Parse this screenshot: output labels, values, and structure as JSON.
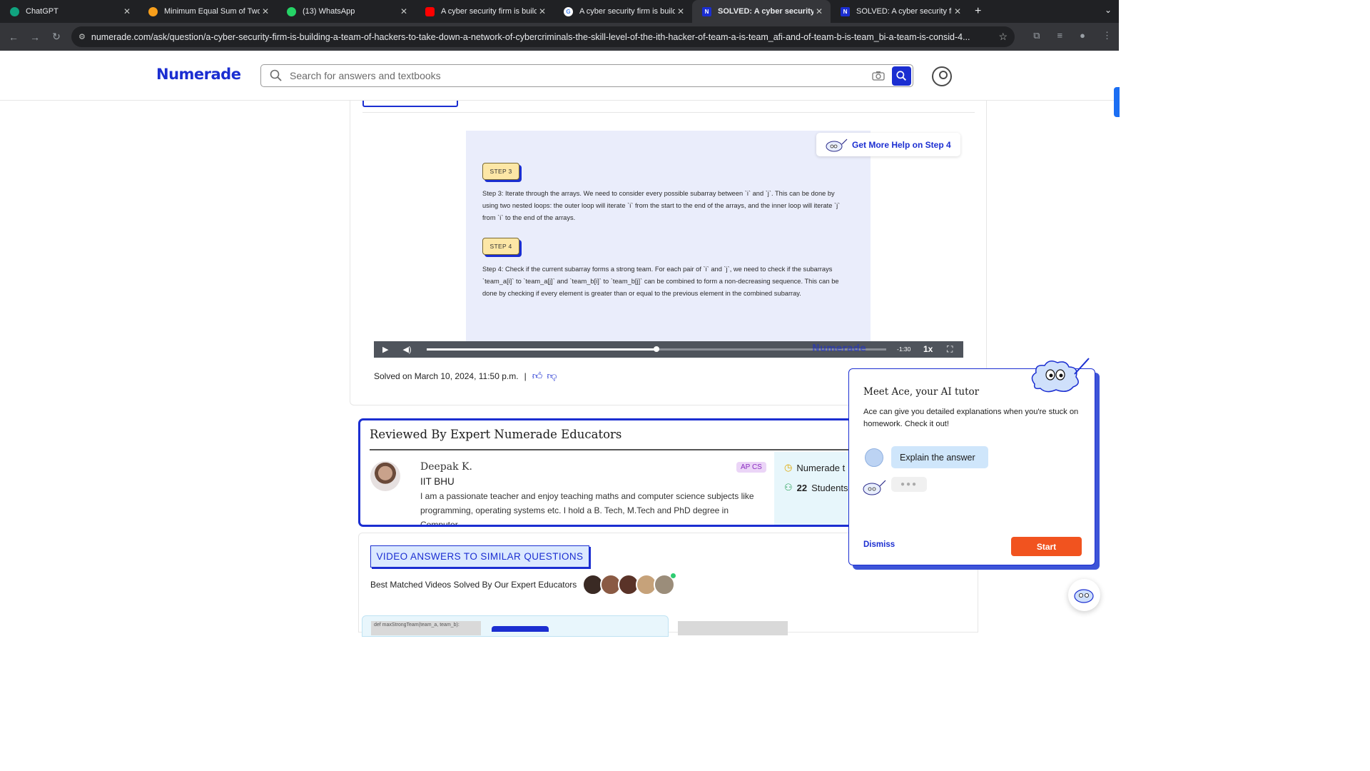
{
  "browser": {
    "tabs": [
      {
        "title": "ChatGPT",
        "favicon": "chatgpt-icon",
        "color": "#10a37f"
      },
      {
        "title": "Minimum Equal Sum of Two Arrays",
        "favicon": "leetcode-icon",
        "color": "#f89f1b"
      },
      {
        "title": "(13) WhatsApp",
        "favicon": "whatsapp-icon",
        "color": "#25d366"
      },
      {
        "title": "A cyber security firm is building",
        "favicon": "youtube-icon",
        "color": "#ff0000"
      },
      {
        "title": "A cyber security firm is building",
        "favicon": "google-icon",
        "color": "#4285f4"
      },
      {
        "title": "SOLVED: A cyber security firm",
        "favicon": "numerade-icon",
        "color": "#1b2ed1"
      },
      {
        "title": "SOLVED: A cyber security firm",
        "favicon": "numerade-icon",
        "color": "#1b2ed1"
      }
    ],
    "active_tab": 5,
    "url": "numerade.com/ask/question/a-cyber-security-firm-is-building-a-team-of-hackers-to-take-down-a-network-of-cybercriminals-the-skill-level-of-the-ith-hacker-of-team-a-is-team_afi-and-of-team-b-is-team_bi-a-team-is-consid-4..."
  },
  "header": {
    "logo": "Numerade",
    "search_placeholder": "Search for answers and textbooks"
  },
  "video": {
    "help_label": "Get More Help on Step 4",
    "steps": [
      {
        "badge": "STEP 3",
        "text": "Step 3: Iterate through the arrays. We need to consider every possible subarray between `i` and `j`. This can be done by using two nested loops: the outer loop will iterate `i` from the start to the end of the arrays, and the inner loop will iterate `j` from `i` to the end of the arrays."
      },
      {
        "badge": "STEP 4",
        "text": "Step 4: Check if the current subarray forms a strong team. For each pair of `i` and `j`, we need to check if the subarrays `team_a[i]` to `team_a[j]` and `team_b[i]` to `team_b[j]` can be combined to form a non-decreasing sequence. This can be done by checking if every element is greater than or equal to the previous element in the combined subarray."
      }
    ],
    "time_remaining": "-1:30",
    "speed": "1x",
    "watermark": "Numerade",
    "progress": 0.5
  },
  "solved": {
    "text": "Solved on March 10, 2024, 11:50 p.m.",
    "separator": "|"
  },
  "review": {
    "title": "Reviewed By Expert Numerade Educators",
    "educator_name": "Deepak K.",
    "educator_school": "IIT BHU",
    "educator_tag": "AP CS",
    "educator_bio": "I am a passionate teacher and enjoy teaching maths and computer science subjects like programming, operating systems etc. I hold a B. Tech, M.Tech and PhD degree in Computer",
    "stat_1": "Numerade t",
    "stat_2_count": "22",
    "stat_2_label": "Students"
  },
  "ace": {
    "title": "Meet Ace, your AI tutor",
    "body": "Ace can give you detailed explanations when you're stuck on homework. Check it out!",
    "explain_label": "Explain the answer",
    "typing": "●●●",
    "dismiss_label": "Dismiss",
    "start_label": "Start"
  },
  "similar": {
    "heading": "VIDEO ANSWERS TO SIMILAR QUESTIONS",
    "subheading": "Best Matched Videos Solved By Our Expert Educators",
    "thumb_text": "def  maxStrongTeam(team_a, team_b):"
  }
}
